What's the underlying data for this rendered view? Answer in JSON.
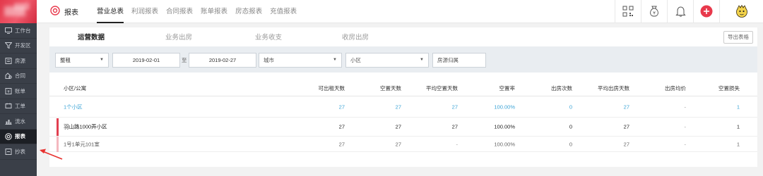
{
  "sidebar": {
    "items": [
      {
        "icon": "monitor-icon",
        "label": "工作台"
      },
      {
        "icon": "filter-icon",
        "label": "开发区"
      },
      {
        "icon": "house-icon",
        "label": "房源"
      },
      {
        "icon": "contract-icon",
        "label": "合同"
      },
      {
        "icon": "bill-icon",
        "label": "账单"
      },
      {
        "icon": "ticket-icon",
        "label": "工单"
      },
      {
        "icon": "chart-icon",
        "label": "流水"
      },
      {
        "icon": "report-icon",
        "label": "报表"
      },
      {
        "icon": "more-icon",
        "label": "抄表"
      }
    ],
    "active_index": 7
  },
  "header": {
    "brand": "报表",
    "tabs": [
      "营业总表",
      "利润报表",
      "合同报表",
      "账单报表",
      "房态报表",
      "充值报表"
    ],
    "active_tab": 0,
    "icons": [
      "qrcode-icon",
      "wallet-icon",
      "bell-icon",
      "add-icon",
      "avatar-icon"
    ],
    "accent": "#e8394c"
  },
  "subtabs": {
    "items": [
      "运营数据",
      "业务出房",
      "业务收支",
      "收房出房"
    ],
    "active": 0,
    "export_label": "导出表格"
  },
  "filters": {
    "rent_type": "整租",
    "date_from": "2019-02-01",
    "to_label": "至",
    "date_to": "2019-02-27",
    "city_placeholder": "城市",
    "community_placeholder": "小区",
    "owner_placeholder": "房源归属"
  },
  "table": {
    "columns": [
      "小区/公寓",
      "可出租天数",
      "空置天数",
      "平均空置天数",
      "空置率",
      "出房次数",
      "平均出房天数",
      "出房均价",
      "空置损失"
    ],
    "rows": [
      {
        "name": "1个小区",
        "cells": [
          "27",
          "27",
          "27",
          "100.00%",
          "0",
          "27",
          "-",
          "1"
        ],
        "style": "summary"
      },
      {
        "name": "羽山路1000弄小区",
        "cells": [
          "27",
          "27",
          "27",
          "100.00%",
          "0",
          "27",
          "-",
          "1"
        ],
        "style": "group"
      },
      {
        "name": "1号1单元101室",
        "cells": [
          "27",
          "27",
          "-",
          "100.00%",
          "0",
          "27",
          "-",
          "1"
        ],
        "style": "unit"
      }
    ]
  }
}
